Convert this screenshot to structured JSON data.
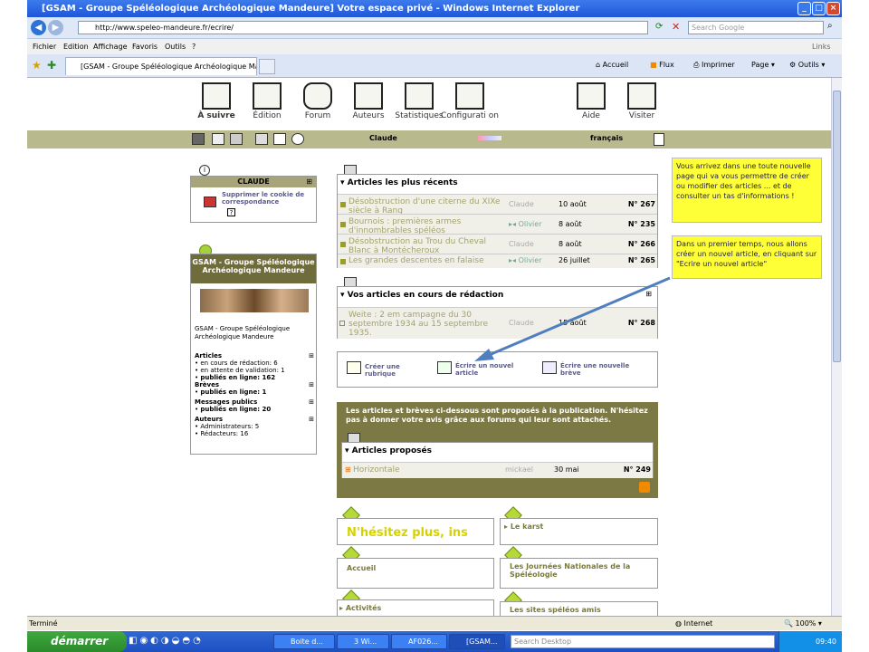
{
  "window": {
    "title": "[GSAM - Groupe Spéléologique Archéologique Mandeure] Votre espace privé - Windows Internet Explorer"
  },
  "address": {
    "url": "http://www.speleo-mandeure.fr/ecrire/",
    "search_placeholder": "Search Google"
  },
  "menu": {
    "items": [
      "Fichier",
      "Edition",
      "Affichage",
      "Favoris",
      "Outils",
      "?"
    ],
    "links": "Links"
  },
  "tabbar": {
    "tab": "[GSAM - Groupe Spéléologique Archéologique Mandeu...",
    "accueil": "Accueil",
    "flux": "Flux",
    "imprimer": "Imprimer",
    "page": "Page",
    "outils": "Outils"
  },
  "nav": {
    "items": [
      "À suivre",
      "Édition",
      "Forum",
      "Auteurs",
      "Statistiques",
      "Configurati on",
      "Aide",
      "Visiter"
    ]
  },
  "olive": {
    "user": "Claude",
    "lang": "français"
  },
  "claude_panel": {
    "title": "CLAUDE",
    "cookie": "Supprimer le cookie de correspondance"
  },
  "site_panel": {
    "title": "GSAM - Groupe Spéléologique Archéologique Mandeure",
    "desc": "GSAM - Groupe Spéléologique Archéologique Mandeure",
    "stats": [
      {
        "head": "Articles",
        "lines": [
          "en cours de rédaction: 6",
          "en attente de validation: 1",
          "publiés en ligne: 162"
        ]
      },
      {
        "head": "Brèves",
        "lines": [
          "publiés en ligne: 1"
        ]
      },
      {
        "head": "Messages publics",
        "lines": [
          "publiés en ligne: 20"
        ]
      },
      {
        "head": "Auteurs",
        "lines": [
          "Administrateurs: 5",
          "Rédacteurs: 16"
        ]
      }
    ]
  },
  "recent": {
    "title": "Articles les plus récents",
    "rows": [
      {
        "title": "Désobstruction d'une citerne du XIXe siècle à Rang",
        "author": "Claude",
        "date": "10 août",
        "num": "N° 267"
      },
      {
        "title": "Bournois : premières armes d'innombrables spéléos",
        "author": "Olivier",
        "date": "8 août",
        "num": "N° 235"
      },
      {
        "title": "Désobstruction au Trou du Cheval Blanc à Montécheroux",
        "author": "Claude",
        "date": "8 août",
        "num": "N° 266"
      },
      {
        "title": "Les grandes descentes en falaise",
        "author": "Olivier",
        "date": "26 juillet",
        "num": "N° 265"
      }
    ]
  },
  "drafts": {
    "title": "Vos articles en cours de rédaction",
    "row": {
      "title": "Weite : 2 em campagne du 30 septembre 1934 au 15 septembre 1935.",
      "author": "Claude",
      "date": "15 août",
      "num": "N° 268"
    }
  },
  "actions": {
    "rubrique": "Créer une rubrique",
    "article": "Écrire un nouvel article",
    "breve": "Écrire une nouvelle brève"
  },
  "proposed": {
    "intro": "Les articles et brèves ci-dessous sont proposés à la publication. N'hésitez pas à donner votre avis grâce aux forums qui leur sont attachés.",
    "title": "Articles proposés",
    "row": {
      "title": "Horizontale",
      "author": "mickael",
      "date": "30 mai",
      "num": "N° 249"
    }
  },
  "tiles": [
    "N'hésitez plus, ins",
    "Le karst",
    "Accueil",
    "Les Journées Nationales de la Spéléologie",
    "Activités",
    "Les sites spéléos amis"
  ],
  "notes": [
    "Vous arrivez dans une toute nouvelle page qui va vous permettre de créer ou modifier des articles ... et de consulter un tas d'informations !",
    "Dans un premier temps, nous allons créer un nouvel article, en cliquant sur \"Ecrire un nouvel article\""
  ],
  "status": {
    "left": "Terminé",
    "zone": "Internet",
    "zoom": "100%"
  },
  "taskbar": {
    "start": "démarrer",
    "tasks": [
      "Boite d...",
      "3 Wi...",
      "AF026...",
      "[GSAM..."
    ],
    "search": "Search Desktop",
    "clock": "09:40"
  }
}
